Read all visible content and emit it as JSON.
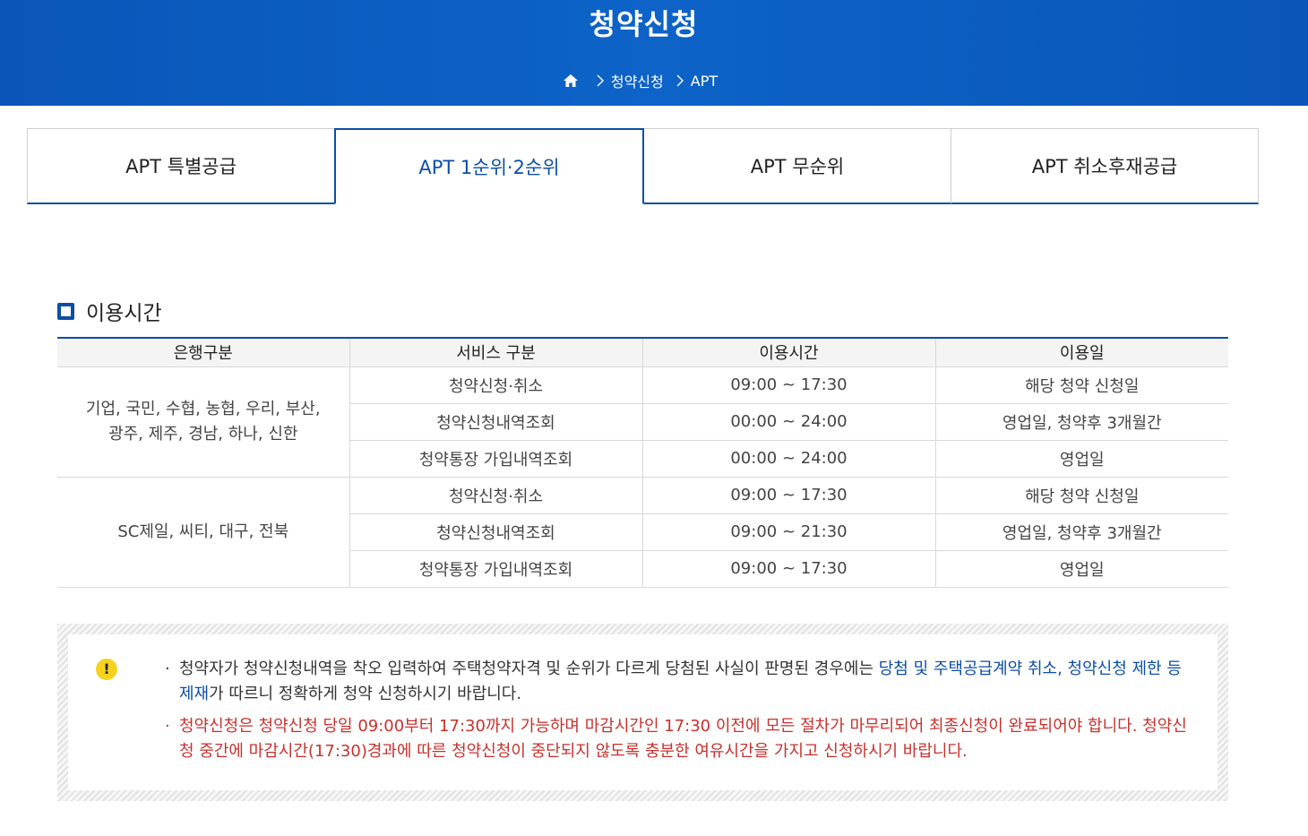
{
  "header": {
    "title": "청약신청",
    "breadcrumb": [
      "청약신청",
      "APT"
    ]
  },
  "tabs": [
    {
      "label": "APT 특별공급",
      "active": false
    },
    {
      "label": "APT 1순위·2순위",
      "active": true
    },
    {
      "label": "APT 무순위",
      "active": false
    },
    {
      "label": "APT 취소후재공급",
      "active": false
    }
  ],
  "section": {
    "title": "이용시간"
  },
  "table": {
    "headers": [
      "은행구분",
      "서비스 구분",
      "이용시간",
      "이용일"
    ],
    "groups": [
      {
        "banks": [
          "기업, 국민, 수협, 농협, 우리, 부산,",
          "광주, 제주, 경남, 하나, 신한"
        ],
        "rows": [
          [
            "청약신청·취소",
            "09:00 ~ 17:30",
            "해당 청약 신청일"
          ],
          [
            "청약신청내역조회",
            "00:00 ~ 24:00",
            "영업일, 청약후 3개월간"
          ],
          [
            "청약통장 가입내역조회",
            "00:00 ~ 24:00",
            "영업일"
          ]
        ]
      },
      {
        "banks": [
          "SC제일, 씨티, 대구, 전북"
        ],
        "rows": [
          [
            "청약신청·취소",
            "09:00 ~ 17:30",
            "해당 청약 신청일"
          ],
          [
            "청약신청내역조회",
            "09:00 ~ 21:30",
            "영업일, 청약후 3개월간"
          ],
          [
            "청약통장 가입내역조회",
            "09:00 ~ 17:30",
            "영업일"
          ]
        ]
      }
    ]
  },
  "notice": {
    "icon": "exclamation-icon",
    "item1": {
      "before": "청약자가 청약신청내역을 착오 입력하여 주택청약자격 및 순위가 다르게 당첨된 사실이 판명된 경우에는 ",
      "highlight": "당첨 및 주택공급계약 취소, 청약신청 제한 등 제재",
      "after": "가 따르니 정확하게 청약 신청하시기 바랍니다."
    },
    "item2": "청약신청은 청약신청 당일 09:00부터 17:30까지 가능하며 마감시간인 17:30 이전에 모든 절차가 마무리되어 최종신청이 완료되어야 합니다. 청약신청 중간에 마감시간(17:30)경과에 따른 청약신청이 중단되지 않도록 충분한 여유시간을 가지고 신청하시기 바랍니다."
  },
  "colors": {
    "brand": "#0c4ea6",
    "banner": "#0a56b8",
    "warning": "#c9302c",
    "warn_icon": "#f4d21e"
  }
}
